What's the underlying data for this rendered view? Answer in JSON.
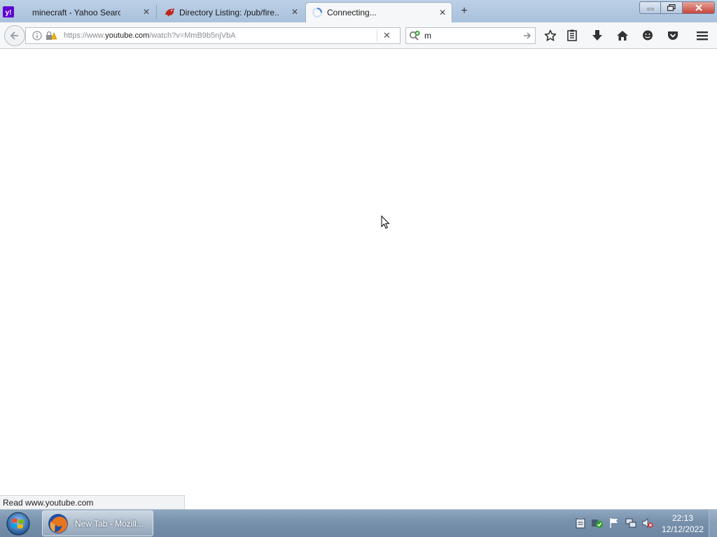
{
  "browser": {
    "tabs": [
      {
        "title": "minecraft - Yahoo Search ...",
        "favicon": "yahoo-icon",
        "active": false
      },
      {
        "title": "Directory Listing: /pub/fire...",
        "favicon": "mozilla-dino-icon",
        "active": false
      },
      {
        "title": "Connecting...",
        "favicon": "loading-spinner-icon",
        "active": true
      }
    ],
    "new_tab_glyph": "+",
    "close_glyph": "✕",
    "window_controls": [
      "minimize",
      "restore",
      "close"
    ]
  },
  "navbar": {
    "url_prefix": "https://www.",
    "url_domain": "youtube.com",
    "url_suffix": "/watch?v=MmB9b5njVbA",
    "search_value": "m",
    "toolbar_icons": [
      "star-icon",
      "reading-list-icon",
      "download-icon",
      "home-icon",
      "chat-icon",
      "pocket-icon",
      "menu-icon"
    ]
  },
  "status": {
    "text": "Read www.youtube.com"
  },
  "taskbar": {
    "window_label": "New Tab - Mozill...",
    "clock_time": "22:13",
    "clock_date": "12/12/2022"
  },
  "colors": {
    "accent": "#3d7fd1",
    "close_red": "#c7453a",
    "taskbar": "#7790ab"
  }
}
